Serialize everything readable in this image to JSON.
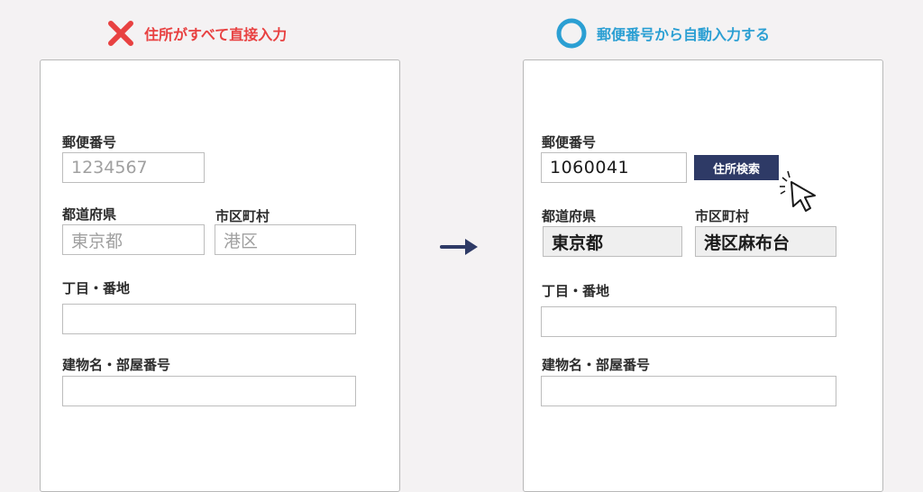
{
  "left": {
    "heading": "住所がすべて直接入力",
    "postal_label": "郵便番号",
    "postal_placeholder": "1234567",
    "prefecture_label": "都道府県",
    "prefecture_placeholder": "東京都",
    "city_label": "市区町村",
    "city_placeholder": "港区",
    "street_label": "丁目・番地",
    "street_value": "",
    "building_label": "建物名・部屋番号",
    "building_value": ""
  },
  "right": {
    "heading": "郵便番号から自動入力する",
    "postal_label": "郵便番号",
    "postal_value": "1060041",
    "search_button": "住所検索",
    "prefecture_label": "都道府県",
    "prefecture_value": "東京都",
    "city_label": "市区町村",
    "city_value": "港区麻布台",
    "street_label": "丁目・番地",
    "street_value": "",
    "building_label": "建物名・部屋番号",
    "building_value": ""
  },
  "icons": {
    "bad": "cross-icon",
    "good": "circle-icon",
    "transition": "arrow-right-icon",
    "pointer": "mouse-pointer-icon"
  },
  "colors": {
    "bad": "#e84141",
    "good": "#2b9fd3",
    "button": "#2e3a66",
    "background": "#f4f2f3"
  }
}
